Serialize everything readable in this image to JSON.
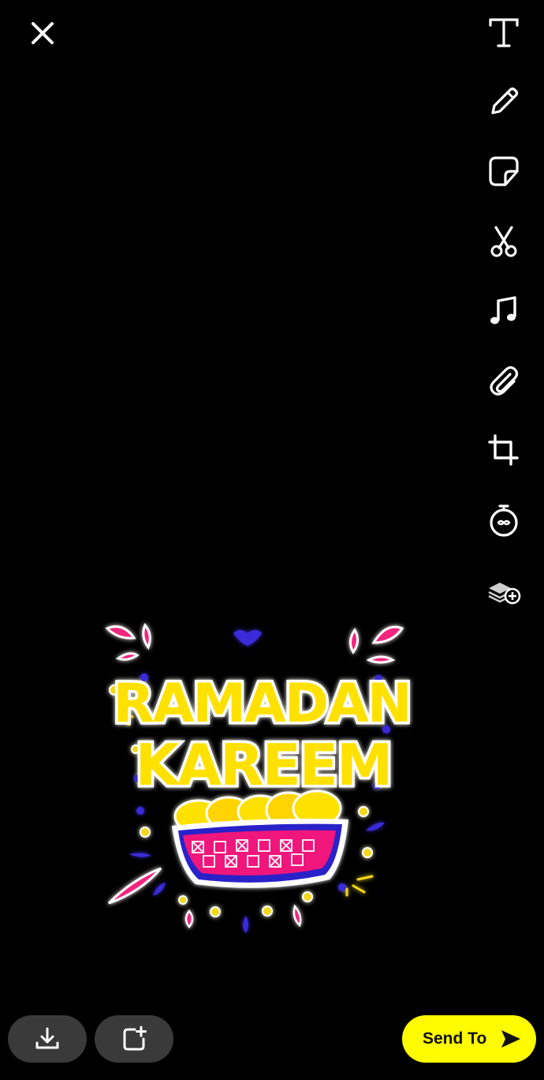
{
  "header": {
    "close_icon": "close-icon"
  },
  "toolbar": {
    "items": [
      {
        "icon": "text-icon"
      },
      {
        "icon": "pencil-icon"
      },
      {
        "icon": "sticker-icon"
      },
      {
        "icon": "scissors-icon"
      },
      {
        "icon": "music-icon"
      },
      {
        "icon": "paperclip-icon"
      },
      {
        "icon": "crop-icon"
      },
      {
        "icon": "timer-icon"
      },
      {
        "icon": "layers-add-icon"
      }
    ]
  },
  "sticker": {
    "line1": "RAMADAN",
    "line2": "KAREEM",
    "colors": {
      "text": "#FFE100",
      "bowl": "#F0147C",
      "rim": "#2B20C9",
      "accent_pink": "#F2267E",
      "accent_blue": "#3B2BD8",
      "dot_yellow": "#F3D81E"
    }
  },
  "footer": {
    "save_icon": "download-icon",
    "story_icon": "add-to-story-icon",
    "send_label": "Send To",
    "send_icon": "send-arrow-icon",
    "send_color": "#FFFC00"
  }
}
